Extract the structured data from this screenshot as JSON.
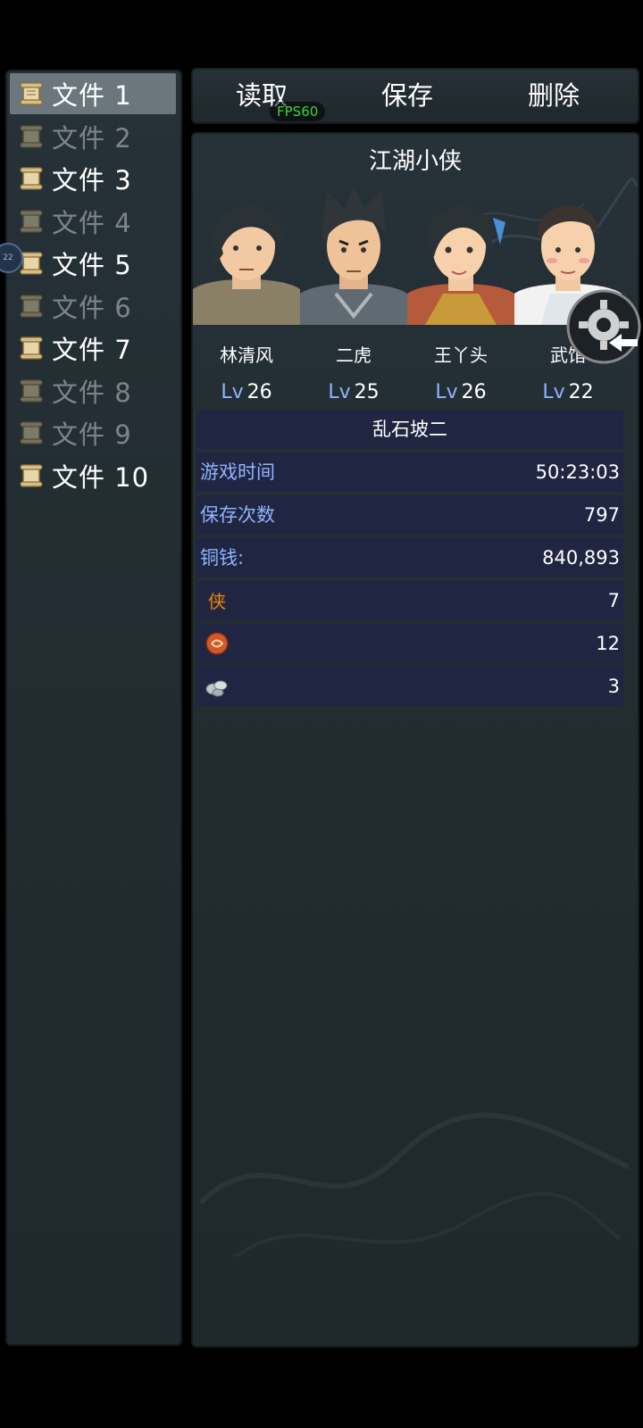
{
  "files": [
    {
      "label": "文件 1",
      "enabled": true,
      "selected": true
    },
    {
      "label": "文件 2",
      "enabled": false
    },
    {
      "label": "文件 3",
      "enabled": true
    },
    {
      "label": "文件 4",
      "enabled": false
    },
    {
      "label": "文件 5",
      "enabled": true
    },
    {
      "label": "文件 6",
      "enabled": false
    },
    {
      "label": "文件 7",
      "enabled": true
    },
    {
      "label": "文件 8",
      "enabled": false
    },
    {
      "label": "文件 9",
      "enabled": false
    },
    {
      "label": "文件 10",
      "enabled": true
    }
  ],
  "toolbar": {
    "load_label": "读取",
    "save_label": "保存",
    "delete_label": "删除"
  },
  "fps": "FPS60",
  "left_bubble": "22",
  "save": {
    "title": "江湖小侠",
    "party": [
      {
        "name": "林清风",
        "lv_prefix": "Lv",
        "lv": "26"
      },
      {
        "name": "二虎",
        "lv_prefix": "Lv",
        "lv": "25"
      },
      {
        "name": "王丫头",
        "lv_prefix": "Lv",
        "lv": "26"
      },
      {
        "name": "武馆",
        "lv_prefix": "Lv",
        "lv": "22"
      }
    ],
    "location": "乱石坡二",
    "stats": [
      {
        "label": "游戏时间",
        "value": "50:23:03"
      },
      {
        "label": "保存次数",
        "value": "797"
      },
      {
        "label": "铜钱:",
        "value": "840,893"
      }
    ],
    "items": [
      {
        "icon": "xia-token-icon",
        "value": "7"
      },
      {
        "icon": "copper-medal-icon",
        "value": "12"
      },
      {
        "icon": "silver-ore-icon",
        "value": "3"
      }
    ]
  },
  "colors": {
    "panel": "#263238",
    "selected": "#6b777c",
    "table_row": "#202541",
    "accent_blue": "#8fb3ff",
    "fps_green": "#3bd43b"
  }
}
